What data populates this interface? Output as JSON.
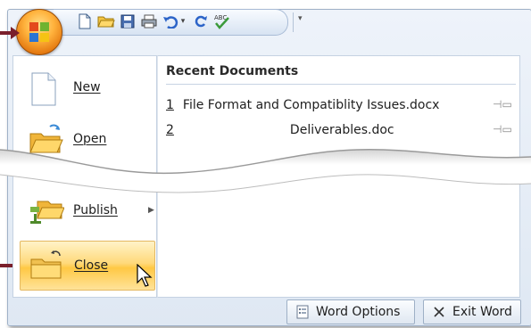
{
  "menu": {
    "items": [
      {
        "label": "New",
        "icon": "blank-document-icon"
      },
      {
        "label": "Open",
        "icon": "open-folder-icon"
      },
      {
        "label": "Publish",
        "icon": "publish-folder-icon"
      },
      {
        "label": "Close",
        "icon": "close-folder-icon"
      }
    ]
  },
  "recent": {
    "header": "Recent Documents",
    "items": [
      {
        "num": "1",
        "name": "File Format and Compatiblity Issues.docx"
      },
      {
        "num": "2",
        "name": "Deliverables.doc"
      }
    ]
  },
  "footer": {
    "word_options_label": "Word Options",
    "exit_word_label": "Exit Word"
  },
  "colors": {
    "accent_arrow": "#7a1f2b",
    "hover_fill": "#ffd97a",
    "orb": "#f29a2e"
  }
}
